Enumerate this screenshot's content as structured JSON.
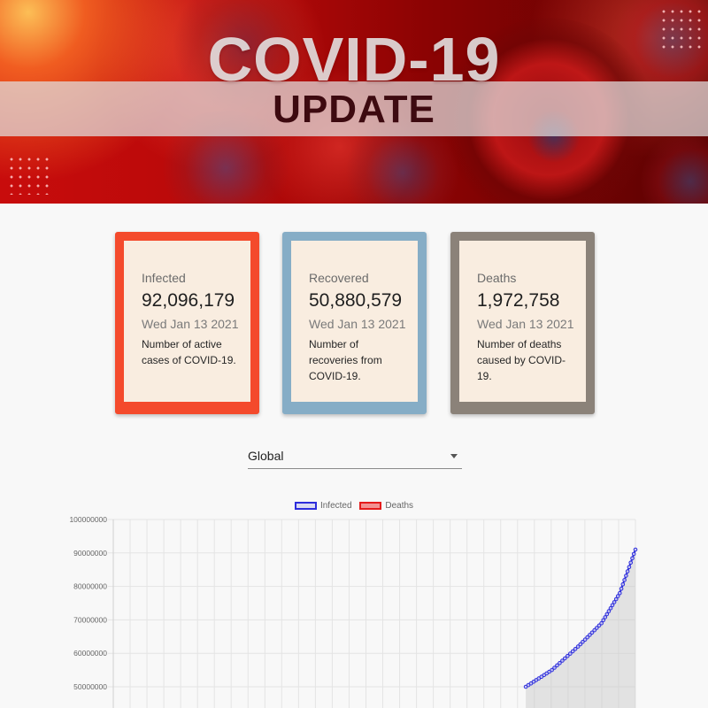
{
  "banner": {
    "title": "COVID-19",
    "subtitle": "UPDATE"
  },
  "cards": [
    {
      "title": "Infected",
      "value": "92,096,179",
      "date": "Wed Jan 13 2021",
      "description": "Number of active cases of COVID-19.",
      "color": "#f44a2c"
    },
    {
      "title": "Recovered",
      "value": "50,880,579",
      "date": "Wed Jan 13 2021",
      "description": "Number of recoveries from COVID-19.",
      "color": "#86adc6"
    },
    {
      "title": "Deaths",
      "value": "1,972,758",
      "date": "Wed Jan 13 2021",
      "description": "Number of deaths caused by COVID-19.",
      "color": "#8b8279"
    }
  ],
  "country_select": {
    "selected": "Global",
    "icon": "chevron-down-icon"
  },
  "chart_data": {
    "type": "line",
    "legend": [
      {
        "name": "Infected",
        "color": "#2d2ddc"
      },
      {
        "name": "Deaths",
        "color": "#e51b1b"
      }
    ],
    "legend_position": "top-center",
    "y_ticks": [
      "100000000",
      "90000000",
      "80000000",
      "70000000",
      "60000000",
      "50000000"
    ],
    "ylim": [
      50000000,
      100000000
    ],
    "grid": true,
    "series": [
      {
        "name": "Infected",
        "end_value": 92096179,
        "visible_points": [
          [
            0.79,
            50000000
          ],
          [
            0.84,
            55000000
          ],
          [
            0.89,
            62000000
          ],
          [
            0.935,
            69000000
          ],
          [
            0.97,
            78000000
          ],
          [
            1.0,
            91000000
          ]
        ]
      }
    ]
  }
}
